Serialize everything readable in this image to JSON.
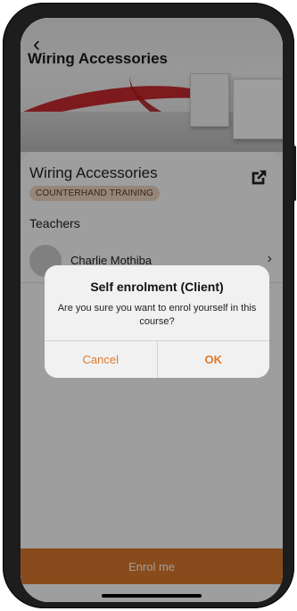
{
  "header": {
    "title": "Wiring Accessories",
    "back_icon": "back-arrow-icon"
  },
  "course": {
    "title": "Wiring Accessories",
    "tag": "COUNTERHAND TRAINING",
    "external_icon": "external-link-icon"
  },
  "teachers": {
    "label": "Teachers",
    "items": [
      {
        "name": "Charlie Mothiba"
      }
    ]
  },
  "enrol": {
    "label": "Enrol me"
  },
  "dialog": {
    "title": "Self enrolment (Client)",
    "message": "Are you sure you want to enrol yourself in this course?",
    "cancel_label": "Cancel",
    "ok_label": "OK"
  },
  "colors": {
    "accent": "#de7a2d",
    "tag_bg": "#f1d9c7"
  }
}
